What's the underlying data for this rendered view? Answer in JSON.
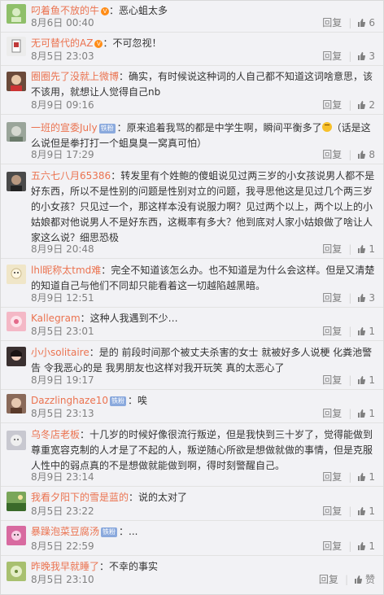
{
  "actions": {
    "reply_label": "回复",
    "like_label": "赞"
  },
  "comments": [
    {
      "user": "叼着鱼不放的牛",
      "vip": true,
      "badge": "",
      "text": "恶心蛆太多",
      "time": "8月6日 00:40",
      "likes": "6",
      "avatar_color": "#8fbf6a"
    },
    {
      "user": "无可替代的AZ",
      "vip": true,
      "badge": "",
      "text": "不可忽视！",
      "time": "8月5日 23:03",
      "likes": "3",
      "avatar_color": "#c9c9c9"
    },
    {
      "user": "圈圈先了没就上微博",
      "vip": false,
      "badge": "",
      "text": "确实，有时候说这种词的人自己都不知道这词啥意思，该不该用，就想让人觉得自己nb",
      "time": "8月9日 09:16",
      "likes": "2",
      "avatar_color": "#6b4a3a"
    },
    {
      "user": "一班的宣委July",
      "vip": false,
      "badge": "铁粉",
      "text": "原来追着我骂的都是中学生啊，瞬间平衡多了",
      "text_after": "（话是这么说但是拳打打一个蛆臭臭一窝真可怕）",
      "emoji": true,
      "time": "8月9日 17:29",
      "likes": "8",
      "avatar_color": "#9aa59a"
    },
    {
      "user": "五六七八月65386",
      "vip": false,
      "badge": "",
      "text": "转发里有个姓鲍的傻蛆说见过两三岁的小女孩说男人都不是好东西，所以不是性别的问题是性别对立的问题，我寻思他这是见过几个两三岁的小女孩？只见过一个，那这样本没有说服力啊？见过两个以上，两个以上的小姑娘都对他说男人不是好东西，这概率有多大？他到底对人家小姑娘做了啥让人家这么说？细思恐极",
      "time": "8月9日 20:48",
      "likes": "1",
      "avatar_color": "#4a4a4a"
    },
    {
      "user": "lhl昵称太tmd难",
      "vip": false,
      "badge": "",
      "text": "完全不知道该怎么办。也不知道是为什么会这样。但是又清楚的知道自己与他们不同却只能看着这一切越陷越黑暗。",
      "time": "8月9日 12:51",
      "likes": "3",
      "avatar_color": "#f0e6c8"
    },
    {
      "user": "Kallegram",
      "vip": false,
      "badge": "",
      "text": "这种人我遇到不少…",
      "time": "8月5日 23:01",
      "likes": "1",
      "avatar_color": "#f4b8c6"
    },
    {
      "user": "小小solitaire",
      "vip": false,
      "badge": "",
      "text": "是的 前段时间那个被丈夫杀害的女士 就被好多人说梗 化粪池警告 令我恶心的是 我男朋友也这样对我开玩笑 真的太恶心了",
      "time": "8月9日 19:17",
      "likes": "1",
      "avatar_color": "#3a3030"
    },
    {
      "user": "Dazzlinghaze10",
      "vip": false,
      "badge": "铁粉",
      "text": "唉",
      "time": "8月5日 23:13",
      "likes": "1",
      "avatar_color": "#8a6a5a"
    },
    {
      "user": "乌冬店老板",
      "vip": false,
      "badge": "",
      "text": "十几岁的时候好像很流行叛逆，但是我快到三十岁了，觉得能做到尊重宽容克制的人才是了不起的人，叛逆随心所欲是想做就做的事情，但是克服人性中的弱点真的不是想做就能做到啊，得时刻警醒自己。",
      "time": "8月9日 23:14",
      "likes": "1",
      "avatar_color": "#c8c8d0"
    },
    {
      "user": "我看夕阳下的雪是蓝的",
      "vip": false,
      "badge": "",
      "text": "说的太对了",
      "time": "8月5日 23:22",
      "likes": "1",
      "avatar_color": "#7aa65a"
    },
    {
      "user": "暴躁泡菜豆腐汤",
      "vip": false,
      "badge": "铁粉",
      "text": "...",
      "time": "8月5日 22:59",
      "likes": "1",
      "avatar_color": "#d86aa0"
    },
    {
      "user": "昨晚我早就睡了",
      "vip": false,
      "badge": "",
      "text": "不幸的事实",
      "time": "8月5日 23:10",
      "likes": "",
      "avatar_color": "#a8c070"
    }
  ]
}
